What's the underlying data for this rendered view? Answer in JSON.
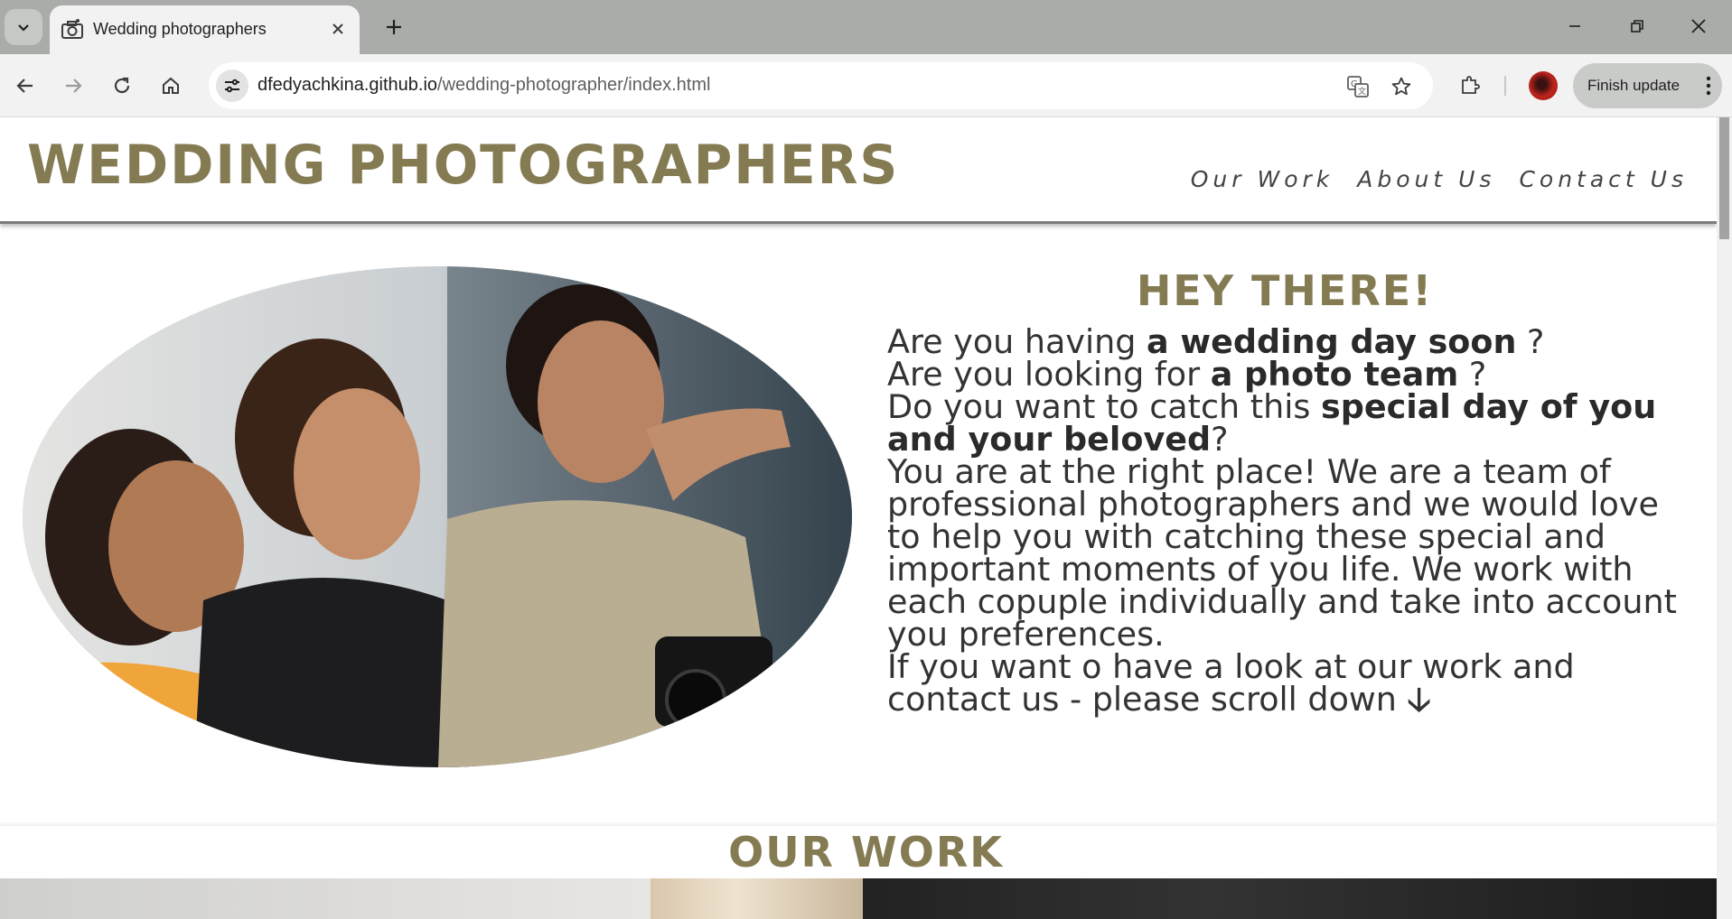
{
  "browser": {
    "tab_title": "Wedding photographers",
    "url_host": "dfedyachkina.github.io",
    "url_path": "/wedding-photographer/index.html",
    "finish_update": "Finish update"
  },
  "site": {
    "logo": "WEDDING PHOTOGRAPHERS",
    "nav": [
      "Our Work",
      "About Us",
      "Contact Us"
    ],
    "hero": {
      "heading": "HEY THERE!",
      "q1_pre": "Are you having ",
      "q1_bold": "a wedding day soon",
      "q1_post": " ?",
      "q2_pre": "Are you looking for ",
      "q2_bold": "a photo team",
      "q2_post": " ?",
      "q3_pre": "Do you want to catch this ",
      "q3_bold": "special day of you and your beloved",
      "q3_post": "?",
      "paragraph": "You are at the right place! We are a team of professional photographers and we would love to help you with catching these special and important moments of you life. We work with each copuple individually and take into account you preferences.",
      "closing": "If you want o have a look at our work and contact us - please scroll down ",
      "arrow": "🡣"
    },
    "our_work_heading": "OUR WORK"
  },
  "colors": {
    "brand": "#847b53",
    "text": "#333333",
    "tabbar": "#a9aca9"
  }
}
